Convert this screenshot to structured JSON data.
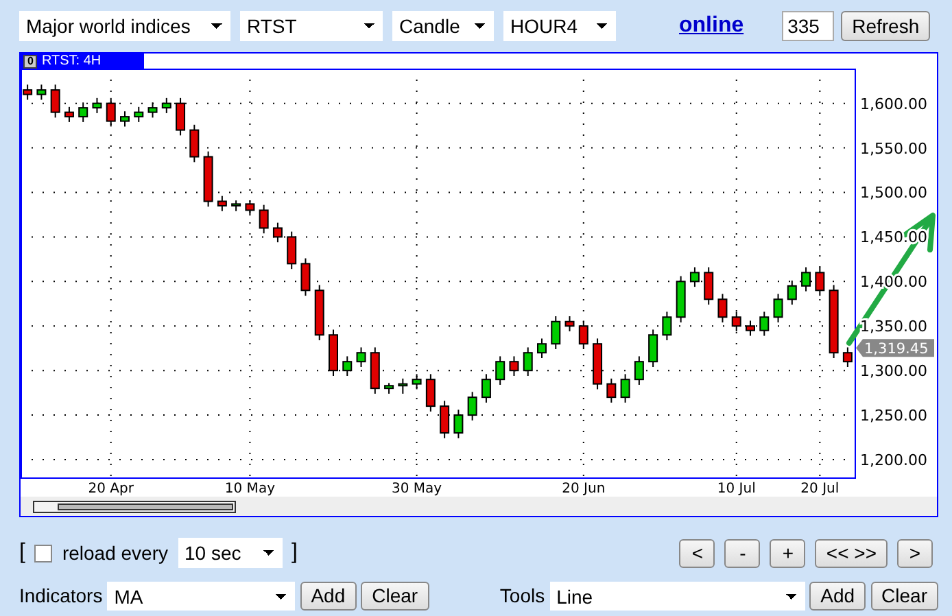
{
  "toolbar": {
    "market": "Major world indices",
    "symbol": "RTST",
    "chart_type": "Candle",
    "period": "HOUR4",
    "online_link": "online",
    "bars": "335",
    "refresh": "Refresh"
  },
  "chart": {
    "tab": {
      "icon": "0",
      "label": "RTST: 4H"
    },
    "last_price": "1,319.45",
    "chart_data": {
      "type": "candlestick",
      "categories": [
        null,
        null,
        null,
        null,
        null,
        null,
        "20 Apr",
        null,
        null,
        null,
        null,
        null,
        null,
        null,
        null,
        null,
        "10 May",
        null,
        null,
        null,
        null,
        null,
        null,
        null,
        null,
        null,
        null,
        null,
        "30 May",
        null,
        null,
        null,
        null,
        null,
        null,
        null,
        null,
        null,
        null,
        null,
        "20 Jun",
        null,
        null,
        null,
        null,
        null,
        null,
        null,
        null,
        null,
        null,
        "10 Jul",
        null,
        null,
        null,
        null,
        null,
        "20 Jul",
        null,
        null
      ],
      "ohlc": [
        [
          1615,
          1621,
          1604,
          1610
        ],
        [
          1610,
          1621,
          1604,
          1615
        ],
        [
          1615,
          1621,
          1584,
          1590
        ],
        [
          1590,
          1596,
          1579,
          1585
        ],
        [
          1585,
          1601,
          1579,
          1595
        ],
        [
          1595,
          1606,
          1589,
          1600
        ],
        [
          1600,
          1606,
          1574,
          1580
        ],
        [
          1580,
          1591,
          1574,
          1585
        ],
        [
          1585,
          1596,
          1579,
          1590
        ],
        [
          1590,
          1601,
          1584,
          1595
        ],
        [
          1595,
          1606,
          1589,
          1600
        ],
        [
          1600,
          1606,
          1564,
          1570
        ],
        [
          1570,
          1576,
          1534,
          1540
        ],
        [
          1540,
          1546,
          1484,
          1490
        ],
        [
          1490,
          1496,
          1479,
          1485
        ],
        [
          1485,
          1491,
          1479,
          1487
        ],
        [
          1487,
          1491,
          1474,
          1480
        ],
        [
          1480,
          1486,
          1454,
          1460
        ],
        [
          1460,
          1466,
          1444,
          1450
        ],
        [
          1450,
          1456,
          1414,
          1420
        ],
        [
          1420,
          1426,
          1384,
          1390
        ],
        [
          1390,
          1396,
          1334,
          1340
        ],
        [
          1340,
          1346,
          1294,
          1300
        ],
        [
          1300,
          1316,
          1294,
          1310
        ],
        [
          1310,
          1326,
          1304,
          1320
        ],
        [
          1320,
          1326,
          1274,
          1280
        ],
        [
          1280,
          1286,
          1274,
          1283
        ],
        [
          1283,
          1291,
          1274,
          1285
        ],
        [
          1285,
          1296,
          1279,
          1290
        ],
        [
          1290,
          1296,
          1254,
          1260
        ],
        [
          1260,
          1266,
          1224,
          1230
        ],
        [
          1230,
          1256,
          1224,
          1250
        ],
        [
          1250,
          1276,
          1244,
          1270
        ],
        [
          1270,
          1296,
          1264,
          1290
        ],
        [
          1290,
          1316,
          1284,
          1310
        ],
        [
          1310,
          1316,
          1294,
          1300
        ],
        [
          1300,
          1326,
          1294,
          1320
        ],
        [
          1320,
          1336,
          1314,
          1330
        ],
        [
          1330,
          1361,
          1324,
          1355
        ],
        [
          1355,
          1361,
          1344,
          1350
        ],
        [
          1350,
          1356,
          1324,
          1330
        ],
        [
          1330,
          1336,
          1279,
          1285
        ],
        [
          1285,
          1291,
          1264,
          1270
        ],
        [
          1270,
          1296,
          1264,
          1290
        ],
        [
          1290,
          1316,
          1284,
          1310
        ],
        [
          1310,
          1346,
          1304,
          1340
        ],
        [
          1340,
          1366,
          1334,
          1360
        ],
        [
          1360,
          1406,
          1354,
          1400
        ],
        [
          1400,
          1416,
          1394,
          1410
        ],
        [
          1410,
          1416,
          1374,
          1380
        ],
        [
          1380,
          1386,
          1354,
          1360
        ],
        [
          1360,
          1366,
          1344,
          1350
        ],
        [
          1350,
          1356,
          1339,
          1345
        ],
        [
          1345,
          1366,
          1339,
          1360
        ],
        [
          1360,
          1386,
          1354,
          1380
        ],
        [
          1380,
          1401,
          1374,
          1395
        ],
        [
          1395,
          1416,
          1389,
          1410
        ],
        [
          1410,
          1416,
          1384,
          1390
        ],
        [
          1390,
          1396,
          1314,
          1320
        ],
        [
          1320,
          1326,
          1304,
          1310
        ]
      ],
      "ylim": [
        1180,
        1639
      ],
      "grid": true,
      "yticks": [
        {
          "value": 1200,
          "label": "1,200.00"
        },
        {
          "value": 1250,
          "label": "1,250.00"
        },
        {
          "value": 1300,
          "label": "1,300.00"
        },
        {
          "value": 1350,
          "label": "1,350.00"
        },
        {
          "value": 1400,
          "label": "1,400.00"
        },
        {
          "value": 1450,
          "label": "1,450.00"
        },
        {
          "value": 1500,
          "label": "1,500.00"
        },
        {
          "value": 1550,
          "label": "1,550.00"
        },
        {
          "value": 1600,
          "label": "1,600.00"
        }
      ]
    }
  },
  "reload": {
    "open_bracket": "[",
    "checked": false,
    "label": "reload every",
    "interval": "10 sec",
    "close_bracket": "]"
  },
  "nav_buttons": [
    "<",
    "-",
    "+",
    "<< >>",
    ">"
  ],
  "indicators": {
    "label": "Indicators",
    "value": "MA",
    "add": "Add",
    "clear": "Clear"
  },
  "tools": {
    "label": "Tools",
    "value": "Line",
    "add": "Add",
    "clear": "Clear"
  }
}
